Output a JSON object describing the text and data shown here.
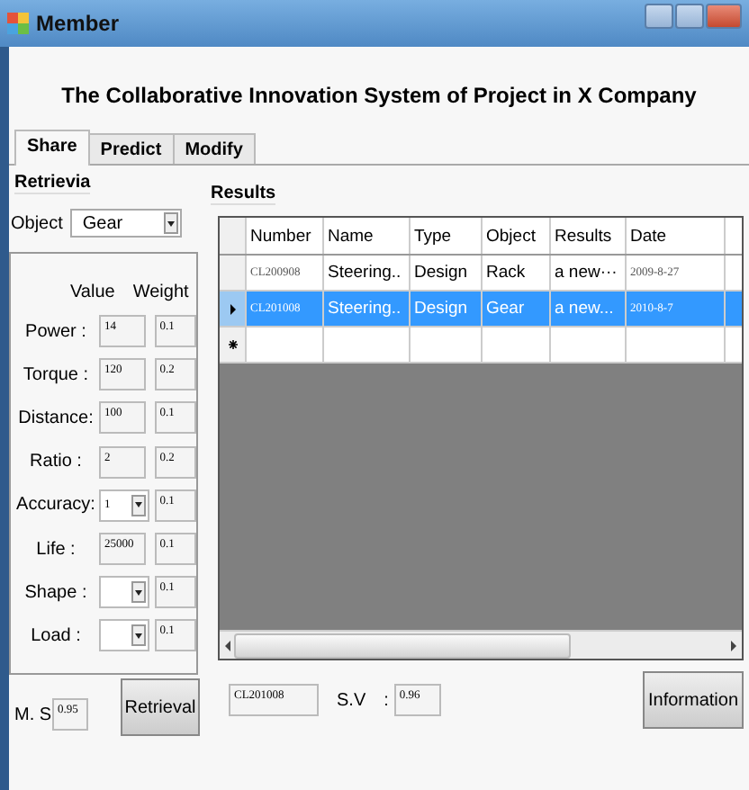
{
  "window": {
    "title": "Member"
  },
  "heading": "The Collaborative Innovation System of Project in  X Company",
  "tabs": [
    {
      "label": "Share",
      "selected": true
    },
    {
      "label": "Predict",
      "selected": false
    },
    {
      "label": "Modify",
      "selected": false
    }
  ],
  "retrieval": {
    "title": "Retrievia",
    "object_label": "Object",
    "object_value": "Gear",
    "value_header": "Value",
    "weight_header": "Weight",
    "params": [
      {
        "label": "Power :",
        "kind": "text",
        "value": "14",
        "weight": "0.1"
      },
      {
        "label": "Torque :",
        "kind": "text",
        "value": "120",
        "weight": "0.2"
      },
      {
        "label": "Distance:",
        "kind": "text",
        "value": "100",
        "weight": "0.1"
      },
      {
        "label": "Ratio :",
        "kind": "text",
        "value": "2",
        "weight": "0.2"
      },
      {
        "label": "Accuracy:",
        "kind": "combo",
        "value": "1",
        "weight": "0.1"
      },
      {
        "label": "Life  :",
        "kind": "text",
        "value": "25000",
        "weight": "0.1"
      },
      {
        "label": "Shape :",
        "kind": "combo",
        "weight": "0.1"
      },
      {
        "label": "Load :",
        "kind": "combo",
        "weight": "0.1"
      }
    ],
    "ms_label": "M. S",
    "ms_value": "0.95",
    "button": "Retrieval"
  },
  "results": {
    "title": "Results",
    "columns": [
      "Number",
      "Name",
      "Type",
      "Object",
      "Results",
      "Date"
    ],
    "rows": [
      {
        "selected": false,
        "cells": [
          "CL200908",
          "Steering..",
          "Design",
          "Rack",
          "a new···",
          "2009-8-27"
        ]
      },
      {
        "selected": true,
        "cells": [
          "CL201008",
          "Steering..",
          "Design",
          "Gear",
          "a new...",
          "2010-8-7"
        ]
      }
    ],
    "selected_number": "CL201008",
    "sv_label": "S.V",
    "sv_colon": ":",
    "sv_value": "0.96",
    "button": "Information"
  }
}
